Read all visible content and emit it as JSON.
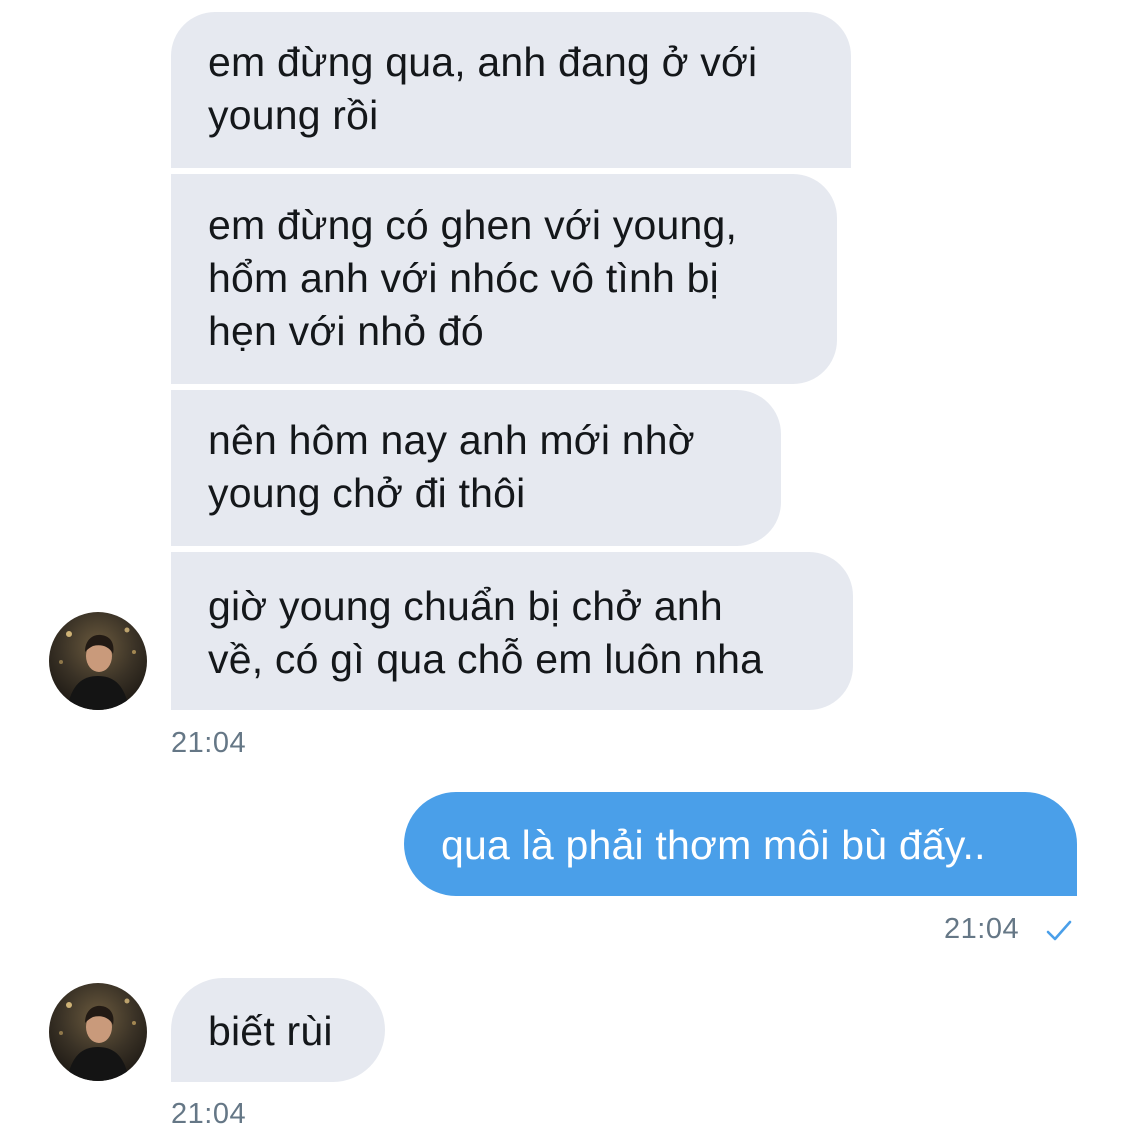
{
  "conversation": {
    "incoming_group_1": {
      "messages": [
        {
          "lines": [
            "em đừng qua, anh đang ở với",
            "young rồi"
          ]
        },
        {
          "lines": [
            "em đừng có ghen với young,",
            "hổm anh với nhóc vô tình bị",
            "hẹn với nhỏ đó"
          ]
        },
        {
          "lines": [
            "nên hôm nay anh mới nhờ",
            "young chở đi thôi"
          ]
        },
        {
          "lines": [
            "giờ young chuẩn bị chở anh",
            "về, có gì qua chỗ em luôn nha"
          ]
        }
      ],
      "time": "21:04"
    },
    "outgoing": {
      "text": "qua là phải thơm môi bù đấy..",
      "time": "21:04",
      "status_icon": "checkmark-icon"
    },
    "incoming_group_2": {
      "messages": [
        {
          "lines": [
            "biết rùi"
          ]
        }
      ],
      "time": "21:04"
    }
  },
  "colors": {
    "incoming_bubble": "#e6e9f0",
    "outgoing_bubble": "#4a9fe9",
    "timestamp": "#657786",
    "check": "#4a9fe9"
  }
}
